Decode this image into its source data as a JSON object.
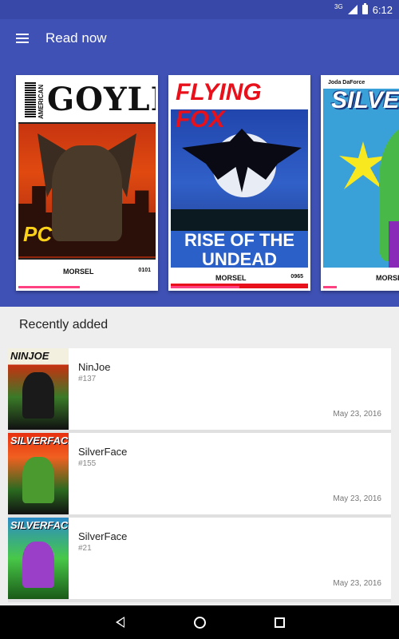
{
  "status_bar": {
    "network": "3G",
    "time": "6:12"
  },
  "app_bar": {
    "title": "Read now"
  },
  "read_now": [
    {
      "cover_title": "GOYLE",
      "cover_prefix": "AMERICAN",
      "publisher": "PC",
      "brand": "MORSEL",
      "issue": "0101",
      "progress": 0.45
    },
    {
      "cover_title": "FLYING FOX",
      "subtitle": "RISE OF THE UNDEAD",
      "brand": "MORSEL",
      "issue": "0965",
      "progress": 0.5
    },
    {
      "cover_title": "SILVERF",
      "byline": "Joda DaForce",
      "brand": "MORSEL",
      "progress": 0.1
    }
  ],
  "recently_added": {
    "heading": "Recently added",
    "items": [
      {
        "title": "NinJoe",
        "issue": "#137",
        "date": "May 23, 2016",
        "thumb_text": "NINJOE"
      },
      {
        "title": "SilverFace",
        "issue": "#155",
        "date": "May 23, 2016",
        "thumb_text": "SILVERFACE"
      },
      {
        "title": "SilverFace",
        "issue": "#21",
        "date": "May 23, 2016",
        "thumb_text": "SILVERFACE"
      }
    ]
  },
  "colors": {
    "primary": "#3f51b5",
    "primary_dark": "#3848a8",
    "accent": "#ff4081"
  }
}
